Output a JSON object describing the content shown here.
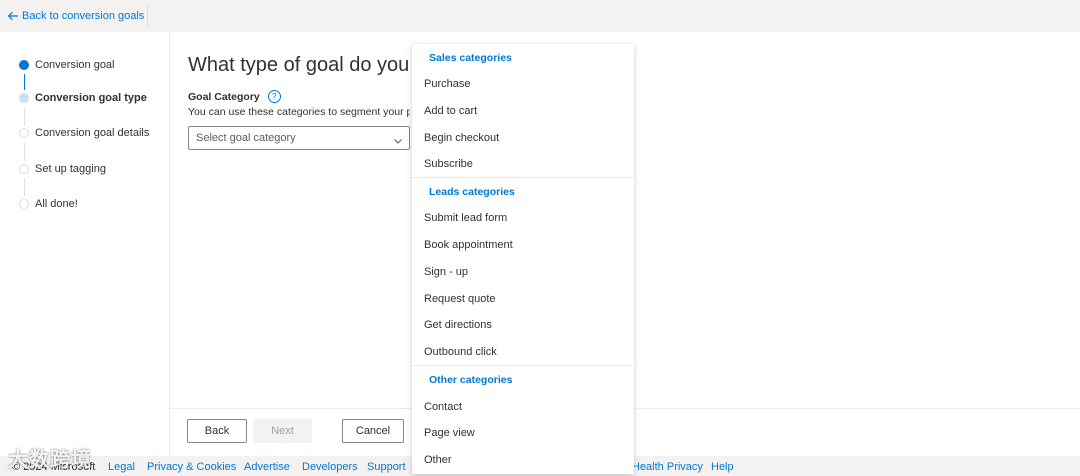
{
  "topbar": {
    "back_label": "Back to conversion goals"
  },
  "wizard": {
    "steps": [
      {
        "label": "Conversion goal",
        "state": "done"
      },
      {
        "label": "Conversion goal type",
        "state": "current"
      },
      {
        "label": "Conversion goal details",
        "state": "todo"
      },
      {
        "label": "Set up tagging",
        "state": "todo"
      },
      {
        "label": "All done!",
        "state": "todo"
      }
    ]
  },
  "main": {
    "title": "What type of goal do you",
    "field_label": "Goal Category",
    "field_description": "You can use these categories to segment your pe",
    "select_placeholder": "Select goal category"
  },
  "dropdown": {
    "groups": [
      {
        "header": "Sales categories",
        "items": [
          "Purchase",
          "Add to cart",
          "Begin checkout",
          "Subscribe"
        ]
      },
      {
        "header": "Leads categories",
        "items": [
          "Submit lead form",
          "Book appointment",
          "Sign - up",
          "Request quote",
          "Get directions",
          "Outbound click"
        ]
      },
      {
        "header": "Other categories",
        "items": [
          "Contact",
          "Page view",
          "Other"
        ]
      }
    ]
  },
  "buttons": {
    "back": "Back",
    "next": "Next",
    "cancel": "Cancel"
  },
  "footer": {
    "copyright": "© 2024 Microsoft",
    "links": [
      "Legal",
      "Privacy & Cookies",
      "Advertise",
      "Developers",
      "Support",
      "Health Privacy",
      "Help"
    ]
  },
  "watermark": "大数跨境",
  "colors": {
    "accent": "#0078d4",
    "text": "#323130",
    "background": "#f3f2f1",
    "panel": "#ffffff"
  }
}
